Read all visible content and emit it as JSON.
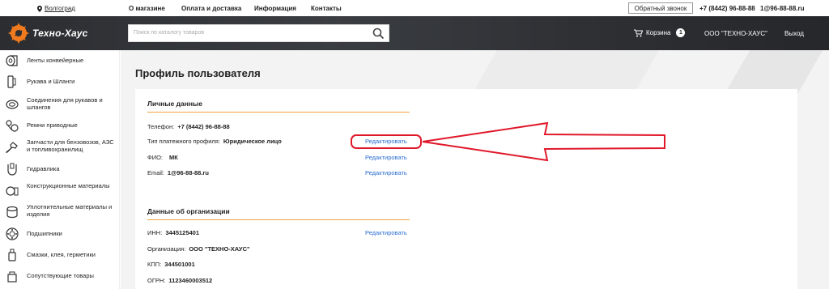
{
  "topbar": {
    "city": "Волгоград",
    "nav": [
      "О магазине",
      "Оплата и доставка",
      "Информация",
      "Контакты"
    ],
    "callback": "Обратный звонок",
    "phone": "+7 (8442) 96-88-88",
    "email": "1@96-88-88.ru"
  },
  "header": {
    "logo_text": "Техно-Хаус",
    "search_placeholder": "Поиск по каталогу товаров",
    "cart_label": "Корзина",
    "cart_count": "1",
    "company": "ООО \"ТЕХНО-ХАУС\"",
    "logout": "Выход"
  },
  "sidebar": {
    "items": [
      {
        "label": "Ленты конвейерные",
        "icon": "conveyor-roll-icon"
      },
      {
        "label": "Рукава и Шланги",
        "icon": "hose-icon"
      },
      {
        "label": "Соединения для рукавов и шлангов",
        "icon": "hose-clamp-icon"
      },
      {
        "label": "Ремни приводные",
        "icon": "drive-belt-icon"
      },
      {
        "label": "Запчасти для бензовозов, АЗС и топливохранилищ",
        "icon": "fuel-nozzle-icon"
      },
      {
        "label": "Гидравлика",
        "icon": "hydraulics-icon"
      },
      {
        "label": "Конструкционные материалы",
        "icon": "materials-icon"
      },
      {
        "label": "Уплотнительные материалы и изделия",
        "icon": "seal-roll-icon"
      },
      {
        "label": "Подшипники",
        "icon": "bearing-icon"
      },
      {
        "label": "Смазки, клея, герметики",
        "icon": "lubricant-bottle-icon"
      },
      {
        "label": "Сопутствующие товары",
        "icon": "misc-goods-icon"
      }
    ]
  },
  "main": {
    "title": "Профиль пользователя",
    "personal": {
      "title": "Личные данные",
      "phone_label": "Телефон:",
      "phone_value": "+7 (8442) 96-88-88",
      "profile_type_label": "Тип платежного профиля:",
      "profile_type_value": "Юридическое лицо",
      "fio_label": "ФИО:",
      "fio_value": "МК",
      "email_label": "Email:",
      "email_value": "1@96-88-88.ru",
      "edit": "Редактировать"
    },
    "org": {
      "title": "Данные об организации",
      "inn_label": "ИНН:",
      "inn_value": "3445125401",
      "org_label": "Организация:",
      "org_value": "ООО \"ТЕХНО-ХАУС\"",
      "kpp_label": "КПП:",
      "kpp_value": "344501001",
      "ogrn_label": "ОГРН:",
      "ogrn_value": "1123460003512",
      "edit": "Редактировать"
    }
  },
  "colors": {
    "accent": "#f0a23a",
    "link": "#2c6fd1",
    "annotation": "#e0182a",
    "header_bg": "#2e3034"
  }
}
